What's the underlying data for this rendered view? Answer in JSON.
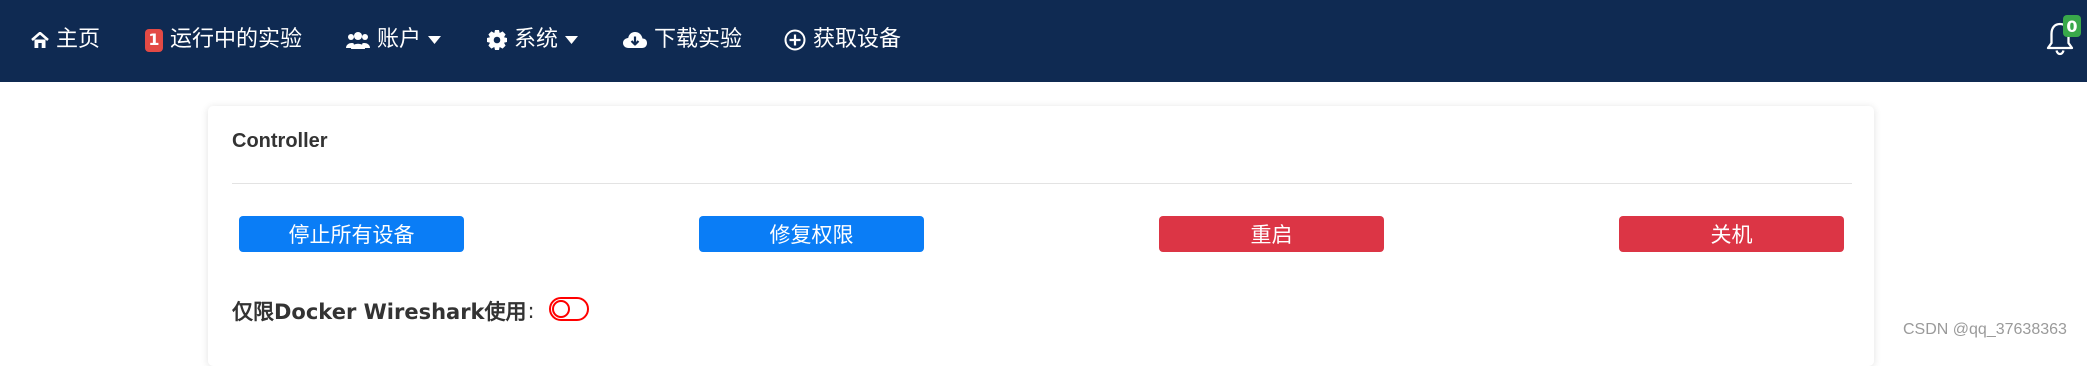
{
  "nav": {
    "home_label": "主页",
    "running_label": "运行中的实验",
    "running_count": "1",
    "account_label": "账户",
    "system_label": "系统",
    "download_label": "下载实验",
    "devices_label": "获取设备",
    "notification_count": "0"
  },
  "icons": {
    "home": "home-icon",
    "users": "users-icon",
    "gear": "gear-icon",
    "caret": "caret-down-icon",
    "download": "cloud-download-icon",
    "add": "plus-circle-icon",
    "bell": "bell-icon"
  },
  "colors": {
    "navbar": "#0f2a52",
    "primary": "#0a7df6",
    "danger": "#dc3545",
    "badge_red": "#e34a45",
    "badge_green": "#39a84a",
    "toggle_border": "#ff0000"
  },
  "controller": {
    "title": "Controller",
    "buttons": {
      "stop_all": "停止所有设备",
      "fix_permissions": "修复权限",
      "restart": "重启",
      "shutdown": "关机"
    },
    "docker_wireshark_label": "仅限Docker Wireshark使用",
    "colon": ":",
    "docker_wireshark_enabled": false
  },
  "watermark": "CSDN @qq_37638363"
}
